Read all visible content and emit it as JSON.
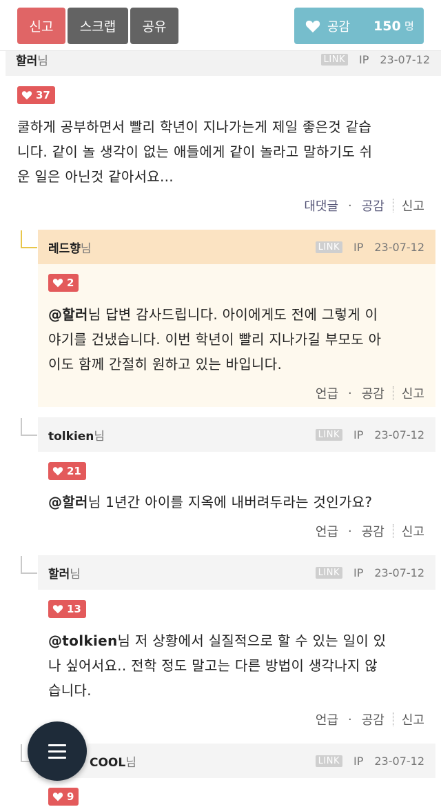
{
  "toolbar": {
    "report_label": "신고",
    "scrap_label": "스크랩",
    "share_label": "공유",
    "like_label": "공감",
    "like_count": "150",
    "like_unit": "명"
  },
  "meta_labels": {
    "link": "LINK",
    "ip": "IP"
  },
  "action_labels": {
    "reply": "대댓글",
    "mention": "언급",
    "like": "공감",
    "report": "신고",
    "dot": "·"
  },
  "comments": [
    {
      "author": "할러",
      "honorific": "님",
      "date": "23-07-12",
      "likes": "37",
      "lines": [
        "쿨하게 공부하면서 빨리 학년이 지나가는게 제일 좋은것 같습",
        "니다. 같이 놀 생각이 없는 애들에게 같이 놀라고 말하기도 쉬",
        "운 일은 아닌것 같아서요..."
      ]
    },
    {
      "author": "레드향",
      "honorific": "님",
      "date": "23-07-12",
      "likes": "2",
      "mention": "@할러",
      "mention_honorific": "님",
      "lines": [
        " 답변 감사드립니다. 아이에게도 전에 그렇게 이",
        "야기를 건냈습니다. 이번 학년이 빨리 지나가길 부모도 아",
        "이도 함께 간절히 원하고 있는 바입니다."
      ]
    },
    {
      "author": "tolkien",
      "honorific": "님",
      "date": "23-07-12",
      "likes": "21",
      "mention": "@할러",
      "mention_honorific": "님",
      "lines": [
        " 1년간 아이를 지옥에 내버려두라는 것인가요?"
      ]
    },
    {
      "author": "할러",
      "honorific": "님",
      "date": "23-07-12",
      "likes": "13",
      "mention": "@tolkien",
      "mention_honorific": "님",
      "lines": [
        " 저 상황에서 실질적으로 할 수 있는 일이 있",
        "나 싶어서요.. 전학 정도 말고는 다른 방법이 생각나지 않",
        "습니다."
      ]
    },
    {
      "author": "COOL",
      "honorific": "님",
      "date": "23-07-12",
      "likes": "9"
    }
  ],
  "colors": {
    "report": "#e06566",
    "neutral": "#636363",
    "like": "#76bdcc",
    "badge": "#e35a5b",
    "highlight": "#fbe3c2",
    "fab": "#1e2b39"
  },
  "icons": {
    "heart": "heart-icon",
    "menu": "hamburger-menu-icon"
  }
}
